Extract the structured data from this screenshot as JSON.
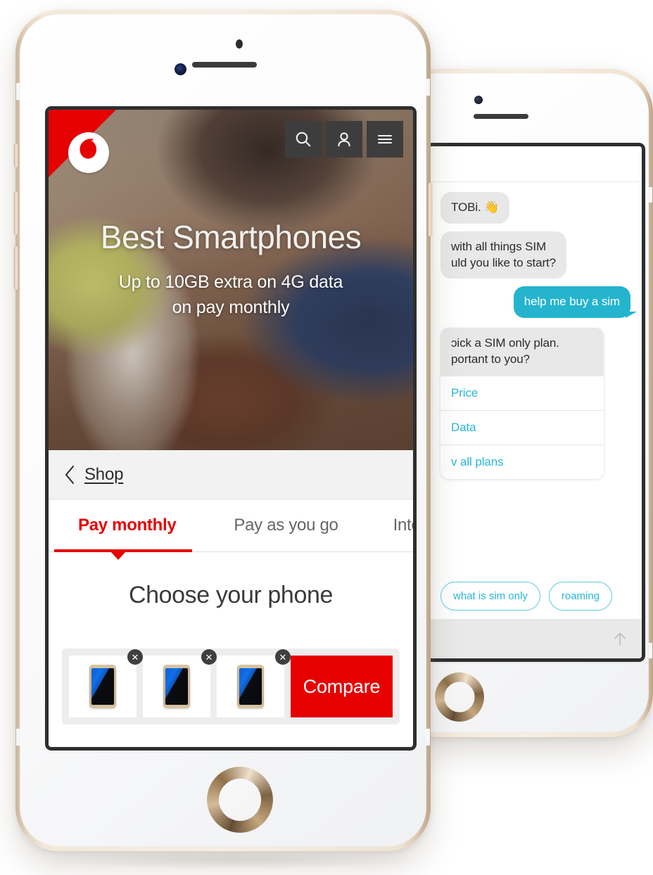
{
  "front_phone": {
    "device": "iphone-gold-white",
    "site": {
      "brand": "Vodafone",
      "logo_name": "vodafone-speechmark-logo",
      "header_icons": [
        {
          "name": "search-icon",
          "label": "Search"
        },
        {
          "name": "account-icon",
          "label": "My account"
        },
        {
          "name": "menu-icon",
          "label": "Menu"
        }
      ],
      "hero": {
        "title": "Best Smartphones",
        "subtitle_line1": "Up to 10GB extra on 4G data",
        "subtitle_line2": "on pay monthly"
      },
      "breadcrumb": {
        "back_icon": "chevron-left-icon",
        "label": "Shop"
      },
      "tabs": [
        {
          "label": "Pay monthly",
          "active": true
        },
        {
          "label": "Pay as you go",
          "active": false
        },
        {
          "label": "Intere",
          "active": false
        }
      ],
      "choose": {
        "heading": "Choose your phone"
      },
      "compare_bar": {
        "slots": [
          {
            "name": "compare-slot-1",
            "remove_label": "✕",
            "device": "galaxy-s7-gold"
          },
          {
            "name": "compare-slot-2",
            "remove_label": "✕",
            "device": "galaxy-s7-gold"
          },
          {
            "name": "compare-slot-3",
            "remove_label": "✕",
            "device": "galaxy-s7-gold"
          }
        ],
        "compare_label": "Compare",
        "compare_color": "#e60000"
      }
    }
  },
  "back_phone": {
    "device": "iphone-gold-white",
    "chat": {
      "messages": [
        {
          "from": "bot",
          "text": "TOBi. 👋"
        },
        {
          "from": "bot",
          "text": "with all things SIM\nuld you like to start?"
        },
        {
          "from": "user",
          "text": "help me buy a sim"
        }
      ],
      "card": {
        "heading": "ɔick a SIM only plan.\nportant to you?",
        "options": [
          {
            "label": "Price"
          },
          {
            "label": "Data"
          },
          {
            "label": "v all plans"
          }
        ]
      },
      "quick_replies": [
        {
          "label": "what is sim only"
        },
        {
          "label": "roaming"
        }
      ],
      "input": {
        "placeholder": "",
        "send_icon": "arrow-up-icon"
      },
      "accent_color": "#29b6d8",
      "user_bubble_color": "#24b4ce",
      "bot_bubble_color": "#e8e8e8"
    }
  }
}
